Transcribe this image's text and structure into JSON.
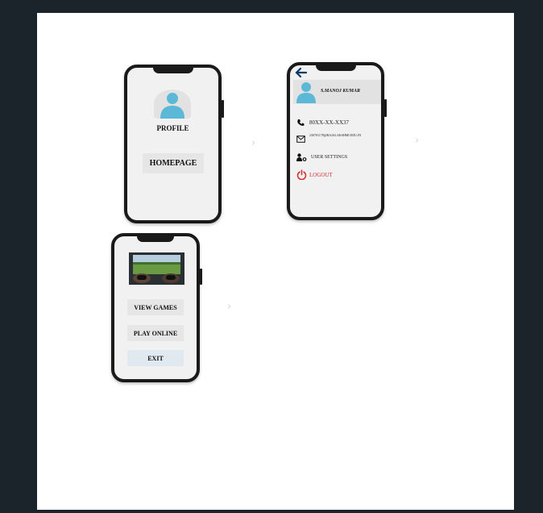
{
  "phone1": {
    "profile_label": "PROFILE",
    "homepage_button": "HOMEPAGE"
  },
  "phone2": {
    "user_name": "S.MANOJ KUMAR",
    "phone_number": "80XX-XX-XX37",
    "email": "230701178@RAJALAKSHMI.EDU.IN",
    "settings_label": "USER SETTINGS",
    "logout_label": "LOGOUT",
    "logout_color": "#d52a2a"
  },
  "phone3": {
    "view_games_button": "VIEW GAMES",
    "play_online_button": "PLAY ONLINE",
    "exit_button": "EXIT",
    "exit_color": "#dfe9ef"
  },
  "icons": {
    "avatar_color": "#5bb8d6",
    "back_arrow_color": "#0d3b66"
  }
}
